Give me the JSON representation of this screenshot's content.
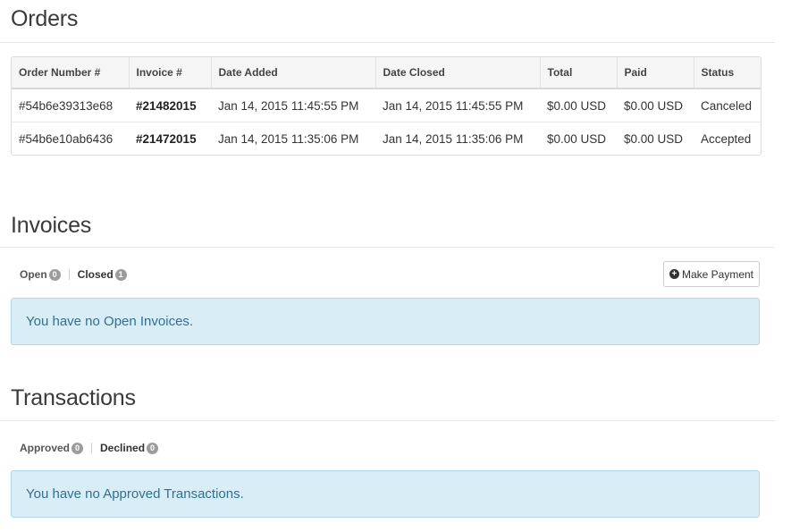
{
  "orders": {
    "title": "Orders",
    "columns": [
      "Order Number #",
      "Invoice #",
      "Date Added",
      "Date Closed",
      "Total",
      "Paid",
      "Status"
    ],
    "rows": [
      [
        "#54b6e39313e68",
        "#21482015",
        "Jan 14, 2015 11:45:55 PM",
        "Jan 14, 2015 11:45:55 PM",
        "$0.00 USD",
        "$0.00 USD",
        "Canceled"
      ],
      [
        "#54b6e10ab6436",
        "#21472015",
        "Jan 14, 2015 11:35:06 PM",
        "Jan 14, 2015 11:35:06 PM",
        "$0.00 USD",
        "$0.00 USD",
        "Accepted"
      ]
    ]
  },
  "invoices": {
    "title": "Invoices",
    "tabs": [
      {
        "label": "Open",
        "count": "0"
      },
      {
        "label": "Closed",
        "count": "1"
      }
    ],
    "make_payment_label": "Make Payment",
    "alert": "You have no Open Invoices."
  },
  "transactions": {
    "title": "Transactions",
    "tabs": [
      {
        "label": "Approved",
        "count": "0"
      },
      {
        "label": "Declined",
        "count": "0"
      }
    ],
    "alert": "You have no Approved Transactions."
  }
}
